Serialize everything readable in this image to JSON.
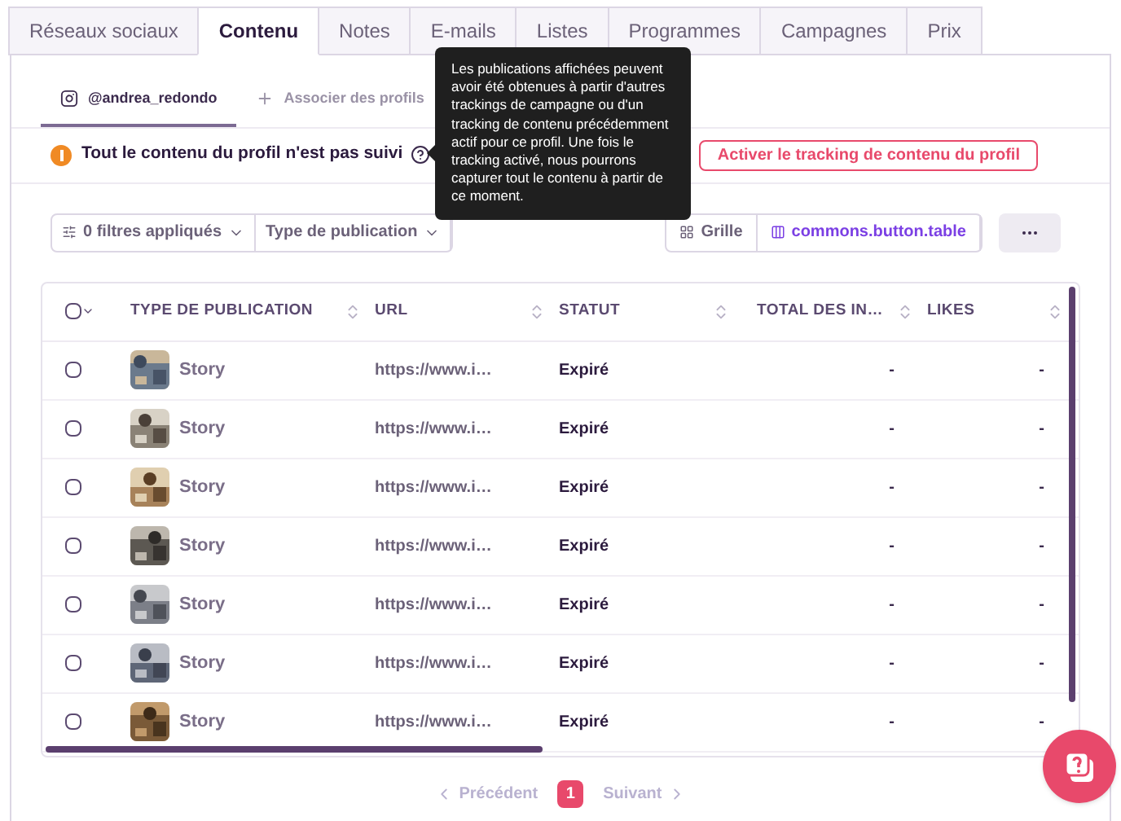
{
  "tabs": [
    {
      "label": "Réseaux sociaux",
      "selected": false
    },
    {
      "label": "Contenu",
      "selected": true
    },
    {
      "label": "Notes",
      "selected": false
    },
    {
      "label": "E-mails",
      "selected": false
    },
    {
      "label": "Listes",
      "selected": false
    },
    {
      "label": "Programmes",
      "selected": false
    },
    {
      "label": "Campagnes",
      "selected": false
    },
    {
      "label": "Prix",
      "selected": false
    }
  ],
  "profile_tabs": [
    {
      "kind": "profile",
      "label": "@andrea_redondo",
      "selected": true
    },
    {
      "kind": "add",
      "label": "Associer des profils",
      "selected": false
    }
  ],
  "warning": {
    "text": "Tout le contenu du profil n'est pas suivi",
    "button": "Activer le tracking de contenu du profil"
  },
  "tooltip": {
    "text": "Les publications affichées peuvent avoir été obtenues à partir d'autres trackings de campagne ou d'un tracking de contenu précédemment actif pour ce profil. Une fois le tracking activé, nous pourrons capturer tout le contenu à partir de ce moment."
  },
  "filters": [
    {
      "label": "0 filtres appliqués"
    },
    {
      "label": "Type de publication"
    }
  ],
  "view_toggle": [
    {
      "kind": "grid",
      "label": "Grille",
      "selected": false
    },
    {
      "kind": "table",
      "label": "commons.button.table",
      "selected": true
    }
  ],
  "table": {
    "select_all_checked": false,
    "columns": [
      "TYPE DE PUBLICATION",
      "URL",
      "STATUT",
      "TOTAL DES IN…",
      "LIKES"
    ],
    "rows": [
      {
        "checked": false,
        "type": "Story",
        "url": "https://www.i…",
        "status": "Expiré",
        "total": "-",
        "likes": "-"
      },
      {
        "checked": false,
        "type": "Story",
        "url": "https://www.i…",
        "status": "Expiré",
        "total": "-",
        "likes": "-"
      },
      {
        "checked": false,
        "type": "Story",
        "url": "https://www.i…",
        "status": "Expiré",
        "total": "-",
        "likes": "-"
      },
      {
        "checked": false,
        "type": "Story",
        "url": "https://www.i…",
        "status": "Expiré",
        "total": "-",
        "likes": "-"
      },
      {
        "checked": false,
        "type": "Story",
        "url": "https://www.i…",
        "status": "Expiré",
        "total": "-",
        "likes": "-"
      },
      {
        "checked": false,
        "type": "Story",
        "url": "https://www.i…",
        "status": "Expiré",
        "total": "-",
        "likes": "-"
      },
      {
        "checked": false,
        "type": "Story",
        "url": "https://www.i…",
        "status": "Expiré",
        "total": "-",
        "likes": "-"
      }
    ]
  },
  "pagination": {
    "previous": "Précédent",
    "pages": [
      {
        "label": "1",
        "selected": true
      }
    ],
    "next": "Suivant"
  }
}
